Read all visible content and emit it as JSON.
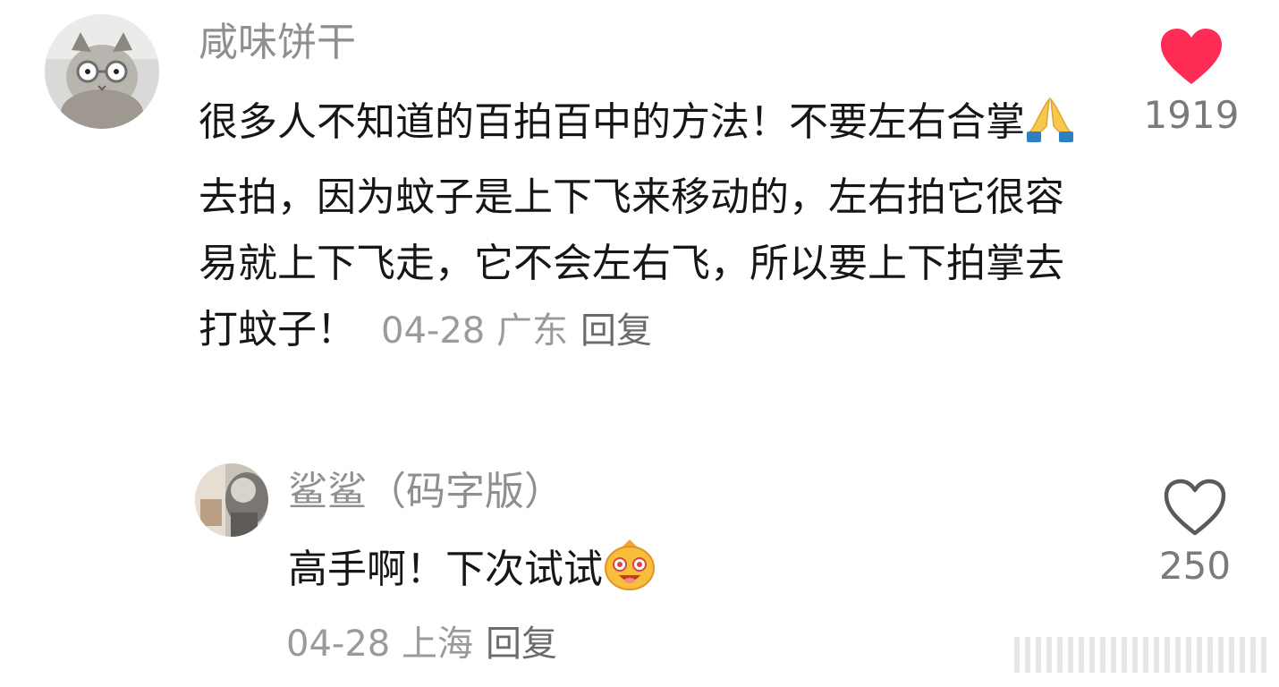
{
  "comments": [
    {
      "username": "咸味饼干",
      "text_before_emoji": "很多人不知道的百拍百中的方法！不要左右合掌",
      "emoji": "folded-hands-emoji",
      "text_after_emoji": "去拍，因为蚊子是上下飞来移动的，左右拍它很容易就上下飞走，它不会左右飞，所以要上下拍掌去打蚊子！",
      "date": "04-28",
      "location": "广东",
      "reply_label": "回复",
      "like_count": "1919",
      "liked": true
    },
    {
      "username": "鲨鲨（码字版）",
      "text": "高手啊！下次试试",
      "emoji": "excited-face-emoji",
      "date": "04-28",
      "location": "上海",
      "reply_label": "回复",
      "like_count": "250",
      "liked": false
    }
  ],
  "colors": {
    "liked_heart": "#fe2c55",
    "unliked_heart": "#5a5a5a",
    "username": "#8f8f8f",
    "meta": "#9a9a9a"
  }
}
